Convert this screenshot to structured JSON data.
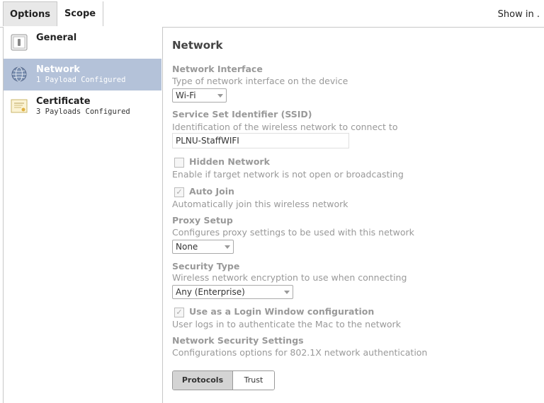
{
  "tabs": {
    "options": "Options",
    "scope": "Scope"
  },
  "header": {
    "show_in": "Show in ."
  },
  "sidebar": {
    "items": [
      {
        "title": "General",
        "subtitle": "",
        "icon": "general-icon"
      },
      {
        "title": "Network",
        "subtitle": "1 Payload Configured",
        "icon": "globe-icon"
      },
      {
        "title": "Certificate",
        "subtitle": "3 Payloads Configured",
        "icon": "certificate-icon"
      }
    ]
  },
  "network": {
    "title": "Network",
    "interface": {
      "label": "Network Interface",
      "desc": "Type of network interface on the device",
      "value": "Wi-Fi"
    },
    "ssid": {
      "label": "Service Set Identifier (SSID)",
      "desc": "Identification of the wireless network to connect to",
      "value": "PLNU-StaffWIFI"
    },
    "hidden": {
      "label": "Hidden Network",
      "desc": "Enable if target network is not open or broadcasting",
      "checked": false
    },
    "auto_join": {
      "label": "Auto Join",
      "desc": "Automatically join this wireless network",
      "checked": true
    },
    "proxy": {
      "label": "Proxy Setup",
      "desc": "Configures proxy settings to be used with this network",
      "value": "None"
    },
    "security": {
      "label": "Security Type",
      "desc": "Wireless network encryption to use when connecting",
      "value": "Any (Enterprise)"
    },
    "login_window": {
      "label": "Use as a Login Window configuration",
      "desc": "User logs in to authenticate the Mac to the network",
      "checked": true
    },
    "security_settings": {
      "label": "Network Security Settings",
      "desc": "Configurations options for 802.1X network authentication"
    },
    "segments": {
      "protocols": "Protocols",
      "trust": "Trust"
    }
  }
}
